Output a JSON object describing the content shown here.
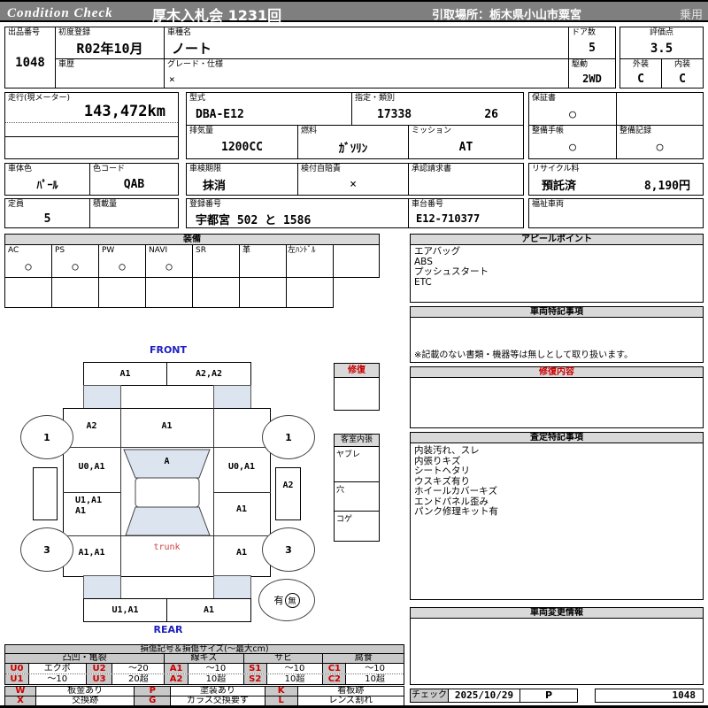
{
  "header": {
    "brand": "Condition Check",
    "auction": "厚木入札会  1231回",
    "pickup": "引取場所：栃木県小山市粟宮",
    "usage": "乗用"
  },
  "info": {
    "lot_label": "出品番号",
    "lot": "1048",
    "first_reg_label": "初度登録",
    "first_reg": "R02年10月",
    "history_label": "車歴",
    "history": "",
    "model_name_label": "車種名",
    "model_name": "ノート",
    "grade_label": "グレード・仕様",
    "grade": "×",
    "doors_label": "ドア数",
    "doors": "5",
    "drive_label": "駆動",
    "drive": "2WD",
    "score_label": "評価点",
    "score": "3.5",
    "exterior_label": "外装",
    "exterior": "C",
    "interior_label": "内装",
    "interior": "C"
  },
  "spec": {
    "odo_label": "走行(現メーター)",
    "odo": "143,472km",
    "model_code_label": "型式",
    "model_code": "DBA-E12",
    "type_label": "指定・類別",
    "type1": "17338",
    "type2": "26",
    "warranty_label": "保証書",
    "warranty": "○",
    "displacement_label": "排気量",
    "displacement": "1200CC",
    "fuel_label": "燃料",
    "fuel": "ｶﾞｿﾘﾝ",
    "mission_label": "ミッション",
    "mission": "AT",
    "maintenance_book_label": "整備手帳",
    "maintenance_book": "○",
    "maintenance_record_label": "整備記録",
    "maintenance_record": "○",
    "color_label": "車体色",
    "color": "ﾊﾟｰﾙ",
    "color_code_label": "色コード",
    "color_code": "QAB",
    "inspection_label": "車検期限",
    "inspection": "抹消",
    "insurance_label": "検付自賠責",
    "insurance": "×",
    "approval_label": "承認請求書",
    "approval": "",
    "recycle_label": "リサイクル料",
    "recycle_status": "預託済",
    "recycle_fee": "8,190円",
    "capacity_label": "定員",
    "capacity": "5",
    "load_label": "積載量",
    "load": "",
    "reg_no_label": "登録番号",
    "reg_no": "宇都宮  502 と  1586",
    "chassis_label": "車台番号",
    "chassis": "E12-710377",
    "welfare_label": "福祉車両",
    "welfare": ""
  },
  "equipment": {
    "title": "装備",
    "items": [
      {
        "label": "AC",
        "value": "○"
      },
      {
        "label": "PS",
        "value": "○"
      },
      {
        "label": "PW",
        "value": "○"
      },
      {
        "label": "NAVI",
        "value": "○"
      },
      {
        "label": "SR",
        "value": ""
      },
      {
        "label": "革",
        "value": ""
      },
      {
        "label": "左ﾊﾝﾄﾞﾙ",
        "value": ""
      },
      {
        "label": "",
        "value": ""
      }
    ]
  },
  "panels": {
    "appeal": {
      "title": "アピールポイント",
      "items": [
        "エアバッグ",
        "ABS",
        "プッシュスタート",
        "ETC"
      ]
    },
    "vehicle_notes": {
      "title": "車両特記事項",
      "note": "※記載のない書類・機器等は無しとして取り扱います。"
    },
    "repair": {
      "title": "修復内容"
    },
    "assessment": {
      "title": "査定特記事項",
      "items": [
        "内装汚れ、スレ",
        "内張りキズ",
        "シートヘタリ",
        "ウスキズ有り",
        "ホイールカバーキズ",
        "エンドパネル歪み",
        "パンク修理キット有"
      ]
    },
    "change_info": {
      "title": "車両変更情報"
    }
  },
  "diagram": {
    "front_label": "FRONT",
    "rear_label": "REAR",
    "repair_box_title": "修復",
    "cabin_box_title": "客室内張",
    "cabin_rows": [
      "ヤブレ",
      "穴",
      "コゲ"
    ],
    "front_bumper_left": "A1",
    "front_bumper_right": "A2,A2",
    "fender_fl": "A2",
    "hood": "A1",
    "fender_fr": "",
    "door_fl": "U0,A1",
    "windshield": "A",
    "door_fr": "U0,A1",
    "side_right": "A2",
    "door_rl_line1": "U1,A1",
    "door_rl_line2": "A1",
    "door_rr": "A1",
    "quarter_l": "A1,A1",
    "trunk": "trunk",
    "quarter_r": "A1",
    "rear_bumper_left": "U1,A1",
    "rear_bumper_right": "A1",
    "wheel_fl": "1",
    "wheel_fr": "1",
    "wheel_rl": "3",
    "wheel_rr": "3",
    "spare_yes": "有",
    "spare_no": "無"
  },
  "legend": {
    "title": "損傷記号＆損傷サイズ(～最大cm)",
    "groups": [
      "凸凹・亀裂",
      "線キズ",
      "サビ",
      "腐食"
    ],
    "rows": [
      [
        {
          "code": "U0",
          "desc": "エクボ"
        },
        {
          "code": "U2",
          "desc": "～20"
        },
        {
          "code": "A1",
          "desc": "～10"
        },
        {
          "code": "S1",
          "desc": "～10"
        },
        {
          "code": "C1",
          "desc": "～10"
        }
      ],
      [
        {
          "code": "U1",
          "desc": "～10"
        },
        {
          "code": "U3",
          "desc": "20超"
        },
        {
          "code": "A2",
          "desc": "10超"
        },
        {
          "code": "S2",
          "desc": "10超"
        },
        {
          "code": "C2",
          "desc": "10超"
        }
      ]
    ],
    "marks": [
      [
        {
          "code": "W",
          "desc": "板金あり"
        },
        {
          "code": "P",
          "desc": "塗装あり"
        },
        {
          "code": "K",
          "desc": "看板跡"
        }
      ],
      [
        {
          "code": "X",
          "desc": "交換跡"
        },
        {
          "code": "G",
          "desc": "ガラス交換要す"
        },
        {
          "code": "L",
          "desc": "レンズ割れ"
        }
      ]
    ]
  },
  "footer": {
    "check_label": "チェック",
    "date": "2025/10/29",
    "checker": "P",
    "lot": "1048"
  }
}
